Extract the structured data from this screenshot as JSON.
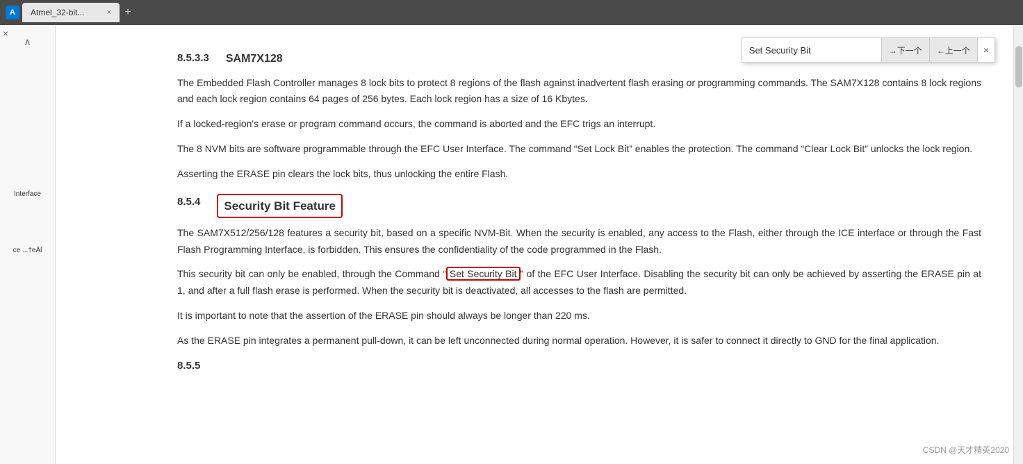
{
  "browser": {
    "tab_label": "Atmel_32-bit...",
    "tab_close": "×",
    "new_tab": "+",
    "icon_text": "A"
  },
  "sidebar": {
    "close_label": "×",
    "scroll_up": "∧",
    "item1": "Interface",
    "item2": "ce ...†eÄl"
  },
  "search": {
    "input_value": "Set Security Bit",
    "next_btn": "→下一个",
    "prev_btn": "←上一个",
    "close_btn": "×"
  },
  "doc": {
    "section_number": "8.5.3.3",
    "section_title": "SAM7X128",
    "para1": "The Embedded Flash Controller manages 8 lock bits to protect 8 regions of the flash against inadvertent flash erasing or programming commands. The SAM7X128 contains 8 lock regions and each lock region contains 64 pages of 256 bytes. Each lock region has a size of 16 Kbytes.",
    "para2": "If a locked-region's erase or program command occurs, the command is aborted and the EFC trigs an interrupt.",
    "para3": "The 8 NVM bits are software programmable through the EFC User Interface. The command “Set Lock Bit” enables the protection. The command “Clear Lock Bit” unlocks the lock region.",
    "para4": "Asserting the ERASE pin clears the lock bits, thus unlocking the entire Flash.",
    "sub_number": "8.5.4",
    "sub_title": "Security Bit Feature",
    "sub_para1": "The SAM7X512/256/128 features a security bit, based on a specific NVM-Bit. When the security is enabled, any access to the Flash, either through the ICE interface or through the Fast Flash Programming Interface, is forbidden. This ensures the confidentiality of the code programmed in the Flash.",
    "sub_para2_part1": "This security bit can only be enabled, through the Command “",
    "sub_para2_highlight": "Set Security Bit",
    "sub_para2_part2": "” of the EFC User Interface. Disabling the security bit can only be achieved by asserting the ERASE pin at 1, and after a full flash erase is performed. When the security bit is deactivated, all accesses to the flash are permitted.",
    "sub_para3": "It is important to note that the assertion of the ERASE pin should always be longer than 220 ms.",
    "sub_para4": "As the ERASE pin integrates a permanent pull-down, it can be left unconnected during normal operation. However, it is safer to connect it directly to GND for the final application.",
    "next_section": "8.5.5",
    "watermark": "CSDN @天才精英2020"
  }
}
